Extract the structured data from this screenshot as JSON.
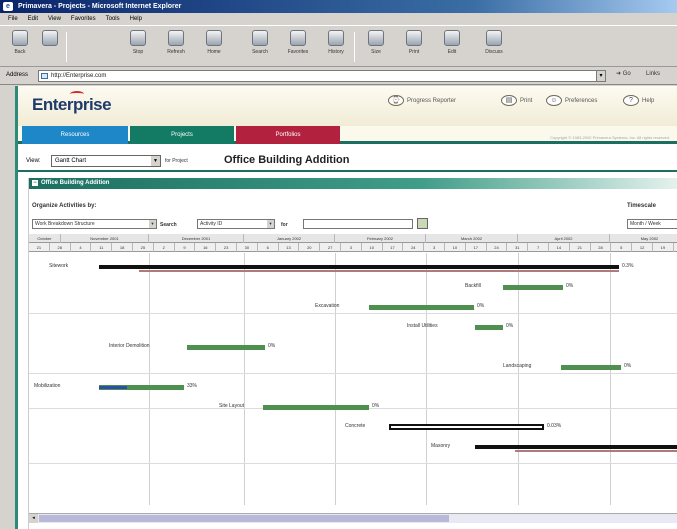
{
  "browser": {
    "title": "Primavera - Projects - Microsoft Internet Explorer",
    "menu": [
      "File",
      "Edit",
      "View",
      "Favorites",
      "Tools",
      "Help"
    ],
    "toolbar": [
      {
        "label": "Back",
        "icon": "back-arrow-icon"
      },
      {
        "label": "",
        "icon": "forward-arrow-icon"
      },
      {
        "label": "Stop",
        "icon": "stop-icon"
      },
      {
        "label": "Refresh",
        "icon": "refresh-icon"
      },
      {
        "label": "Home",
        "icon": "home-icon"
      },
      {
        "label": "Search",
        "icon": "search-icon"
      },
      {
        "label": "Favorites",
        "icon": "favorites-icon"
      },
      {
        "label": "History",
        "icon": "history-icon"
      },
      {
        "label": "Size",
        "icon": "text-size-icon"
      },
      {
        "label": "Print",
        "icon": "print-icon"
      },
      {
        "label": "Edit",
        "icon": "edit-icon"
      },
      {
        "label": "Discuss",
        "icon": "discuss-icon"
      }
    ],
    "address_label": "Address",
    "address_value": "http://Enterprise.com",
    "go_label": "Go",
    "links_label": "Links"
  },
  "app": {
    "logo": "Enterprise",
    "header_links": [
      "Progress Reporter",
      "Print",
      "Preferences",
      "Help"
    ],
    "tabs": [
      {
        "label": "Resources",
        "color": "#1e87c8"
      },
      {
        "label": "Projects",
        "color": "#137a63"
      },
      {
        "label": "Portfolios",
        "color": "#b2223f"
      }
    ],
    "copyright": "Copyright © 1983-2002 Primavera Systems, Inc. All rights reserved.",
    "view_label": "View:",
    "view_value": "Gantt Chart",
    "project_label": "for Project",
    "project_name": "Office Building Addition",
    "section_title": "Office Building Addition",
    "organize_label": "Organize Activities by:",
    "organize_value": "Work Breakdown Structure",
    "search_label": "Search",
    "search_value": "Activity ID",
    "for_label": "for",
    "timescale_label": "Timescale",
    "timescale_value": "Month / Week"
  },
  "gantt": {
    "months": [
      "October",
      "November 2001",
      "December 2001",
      "January 2002",
      "February 2002",
      "March 2002",
      "April 2002",
      "May 2002"
    ],
    "days": [
      "21",
      "28",
      "4",
      "11",
      "18",
      "25",
      "2",
      "9",
      "16",
      "23",
      "30",
      "6",
      "13",
      "20",
      "27",
      "3",
      "10",
      "17",
      "24",
      "3",
      "10",
      "17",
      "24",
      "31",
      "7",
      "14",
      "21",
      "28",
      "5",
      "12",
      "19"
    ],
    "tasks": [
      {
        "name": "Sitework",
        "pct": "0.3%",
        "kind": "summary"
      },
      {
        "name": "Backfill",
        "pct": "0%",
        "kind": "task"
      },
      {
        "name": "Excavation",
        "pct": "0%",
        "kind": "task"
      },
      {
        "name": "Install Utilities",
        "pct": "0%",
        "kind": "task"
      },
      {
        "name": "Interior Demolition",
        "pct": "0%",
        "kind": "task"
      },
      {
        "name": "Landscaping",
        "pct": "0%",
        "kind": "task"
      },
      {
        "name": "Mobilization",
        "pct": "33%",
        "kind": "progress"
      },
      {
        "name": "Site Layout",
        "pct": "0%",
        "kind": "task"
      },
      {
        "name": "Concrete",
        "pct": "0.03%",
        "kind": "outline"
      },
      {
        "name": "Masonry",
        "pct": "",
        "kind": "summary"
      }
    ]
  }
}
